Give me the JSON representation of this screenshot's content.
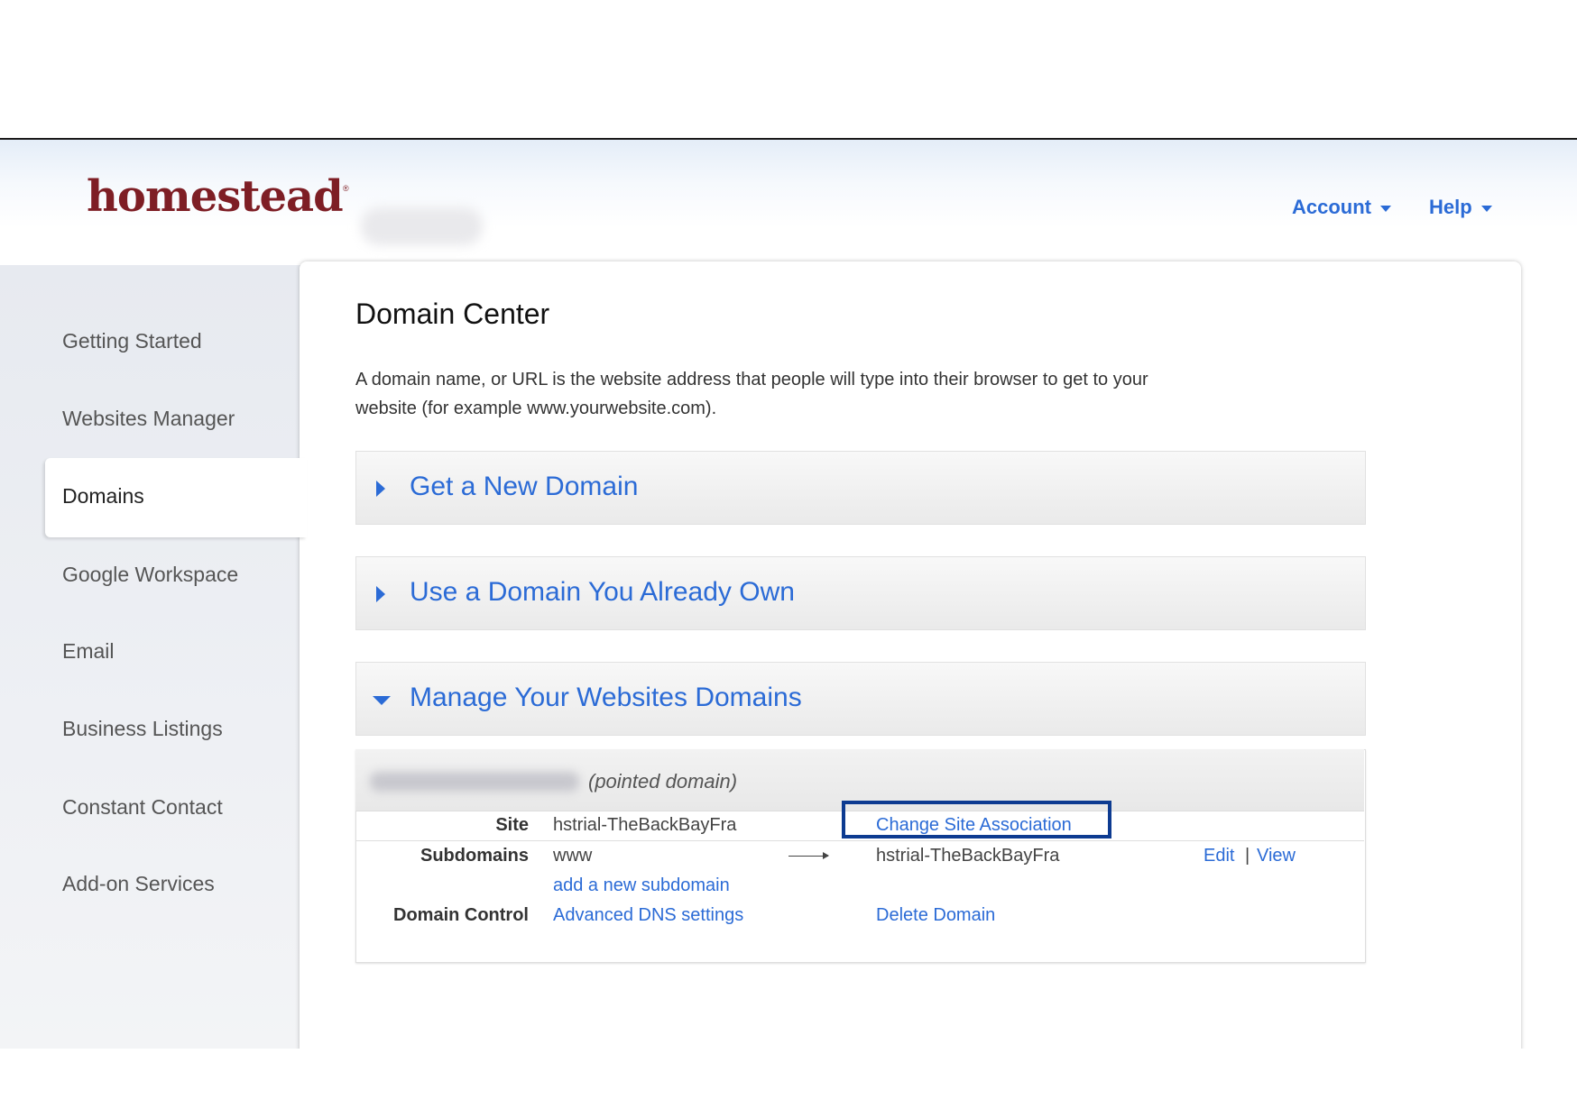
{
  "header": {
    "logo": "homestead",
    "logo_mark": "®",
    "nav": [
      {
        "label": "Account",
        "icon": "caret-down-icon"
      },
      {
        "label": "Help",
        "icon": "caret-down-icon"
      }
    ]
  },
  "sidebar": {
    "items": [
      {
        "label": "Getting Started",
        "active": false
      },
      {
        "label": "Websites Manager",
        "active": false
      },
      {
        "label": "Domains",
        "active": true
      },
      {
        "label": "Google Workspace",
        "active": false
      },
      {
        "label": "Email",
        "active": false
      },
      {
        "label": "Business Listings",
        "active": false
      },
      {
        "label": "Constant Contact",
        "active": false
      },
      {
        "label": "Add-on Services",
        "active": false
      }
    ]
  },
  "main": {
    "title": "Domain Center",
    "description": "A domain name, or URL is the website address that people will type into their browser to get to your website (for example www.yourwebsite.com).",
    "sections": [
      {
        "label": "Get a New Domain",
        "expanded": false
      },
      {
        "label": "Use a Domain You Already Own",
        "expanded": false
      },
      {
        "label": "Manage Your Websites Domains",
        "expanded": true
      }
    ],
    "domain": {
      "type_label": "(pointed domain)",
      "site_label": "Site",
      "site_value": "hstrial-TheBackBayFra",
      "change_site_link": "Change Site Association",
      "subdomains_label": "Subdomains",
      "subdomain_value": "www",
      "subdomain_target": "hstrial-TheBackBayFra",
      "edit_link": "Edit",
      "separator": "|",
      "view_link": "View",
      "add_subdomain_link": "add a new subdomain",
      "domain_control_label": "Domain Control",
      "dns_link": "Advanced DNS settings",
      "delete_link": "Delete Domain"
    }
  },
  "colors": {
    "brand": "#7e1e25",
    "link": "#2b6bd6",
    "highlight": "#0d3b91"
  }
}
